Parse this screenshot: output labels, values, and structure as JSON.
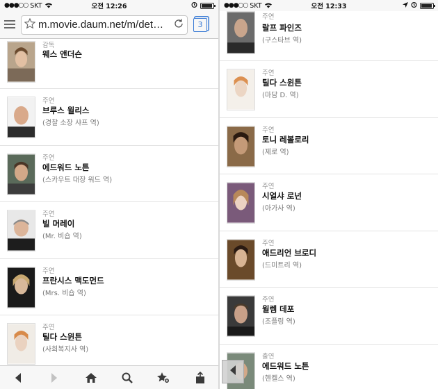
{
  "left_screen": {
    "status": {
      "carrier": "SKT",
      "time": "오전 12:26"
    },
    "url": "m.movie.daum.net/m/det…",
    "tab_count": "3",
    "cast": [
      {
        "role": "감독",
        "name": "웨스 앤더슨",
        "character": ""
      },
      {
        "role": "주연",
        "name": "브루스 윌리스",
        "character": "(경찰 소장 샤프 역)"
      },
      {
        "role": "주연",
        "name": "에드워드 노튼",
        "character": "(스카우트 대장 워드 역)"
      },
      {
        "role": "주연",
        "name": "빌 머레이",
        "character": "(Mr. 비숍 역)"
      },
      {
        "role": "주연",
        "name": "프란시스 맥도먼드",
        "character": "(Mrs. 비숍 역)"
      },
      {
        "role": "주연",
        "name": "틸다 스윈튼",
        "character": "(사회복지사 역)"
      }
    ],
    "toolbar": [
      "back-icon",
      "forward-icon",
      "home-icon",
      "search-icon",
      "bookmark-star-icon",
      "share-icon"
    ]
  },
  "right_screen": {
    "status": {
      "carrier": "SKT",
      "time": "오전 12:33"
    },
    "cast": [
      {
        "role": "주연",
        "name": "랄프 파인즈",
        "character": "(구스타브 역)"
      },
      {
        "role": "주연",
        "name": "틸다 스윈튼",
        "character": "(마담 D. 역)"
      },
      {
        "role": "주연",
        "name": "토니 레볼로리",
        "character": "(제로 역)"
      },
      {
        "role": "주연",
        "name": "시얼샤 로넌",
        "character": "(아가사 역)"
      },
      {
        "role": "주연",
        "name": "애드리언 브로디",
        "character": "(드미트리 역)"
      },
      {
        "role": "주연",
        "name": "윌렘 데포",
        "character": "(조플링 역)"
      },
      {
        "role": "출연",
        "name": "에드워드 노튼",
        "character": "(헨켈스 역)"
      }
    ]
  },
  "battery_level": 0.85
}
